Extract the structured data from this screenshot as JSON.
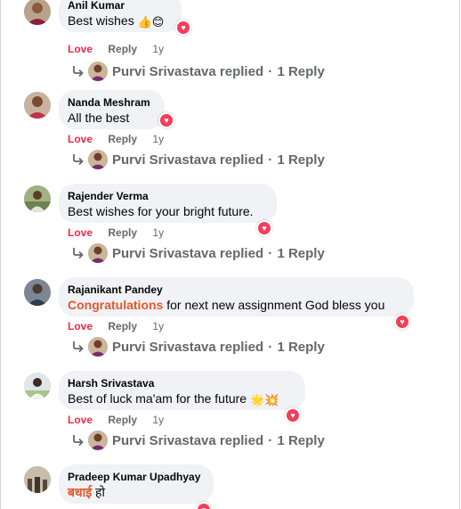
{
  "actions": {
    "love": "Love",
    "reply": "Reply"
  },
  "comments": [
    {
      "author": "Anil Kumar",
      "text_main": "Best wishes ",
      "emojis": "👍😊",
      "time": "1y",
      "reply_author": "Purvi Srivastava",
      "reply_label": "replied",
      "reply_count": "1 Reply"
    },
    {
      "author": "Nanda Meshram",
      "text_main": "All the best",
      "time": "1y",
      "reply_author": "Purvi Srivastava",
      "reply_label": "replied",
      "reply_count": "1 Reply"
    },
    {
      "author": "Rajender Verma",
      "text_main": "Best wishes for your bright future.",
      "time": "1y",
      "reply_author": "Purvi Srivastava",
      "reply_label": "replied",
      "reply_count": "1 Reply"
    },
    {
      "author": "Rajanikant Pandey",
      "text_highlight": "Congratulations",
      "text_main": " for next new assignment God bless you",
      "time": "1y",
      "reply_author": "Purvi Srivastava",
      "reply_label": "replied",
      "reply_count": "1 Reply"
    },
    {
      "author": "Harsh Srivastava",
      "text_main": "Best of luck ma'am for the future ",
      "emojis": "🌟💥",
      "time": "1y",
      "reply_author": "Purvi Srivastava",
      "reply_label": "replied",
      "reply_count": "1 Reply"
    },
    {
      "author": "Pradeep Kumar Upadhyay",
      "text_highlight": "बधाई",
      "text_main": " हो"
    }
  ],
  "icons": {
    "reaction": "heart-icon",
    "reply": "reply-arrow-icon"
  },
  "colors": {
    "love": "#f02849",
    "heart": "#f33e58",
    "bubble": "#f0f2f5",
    "muted": "#65676b",
    "highlight": "#e4572e"
  }
}
